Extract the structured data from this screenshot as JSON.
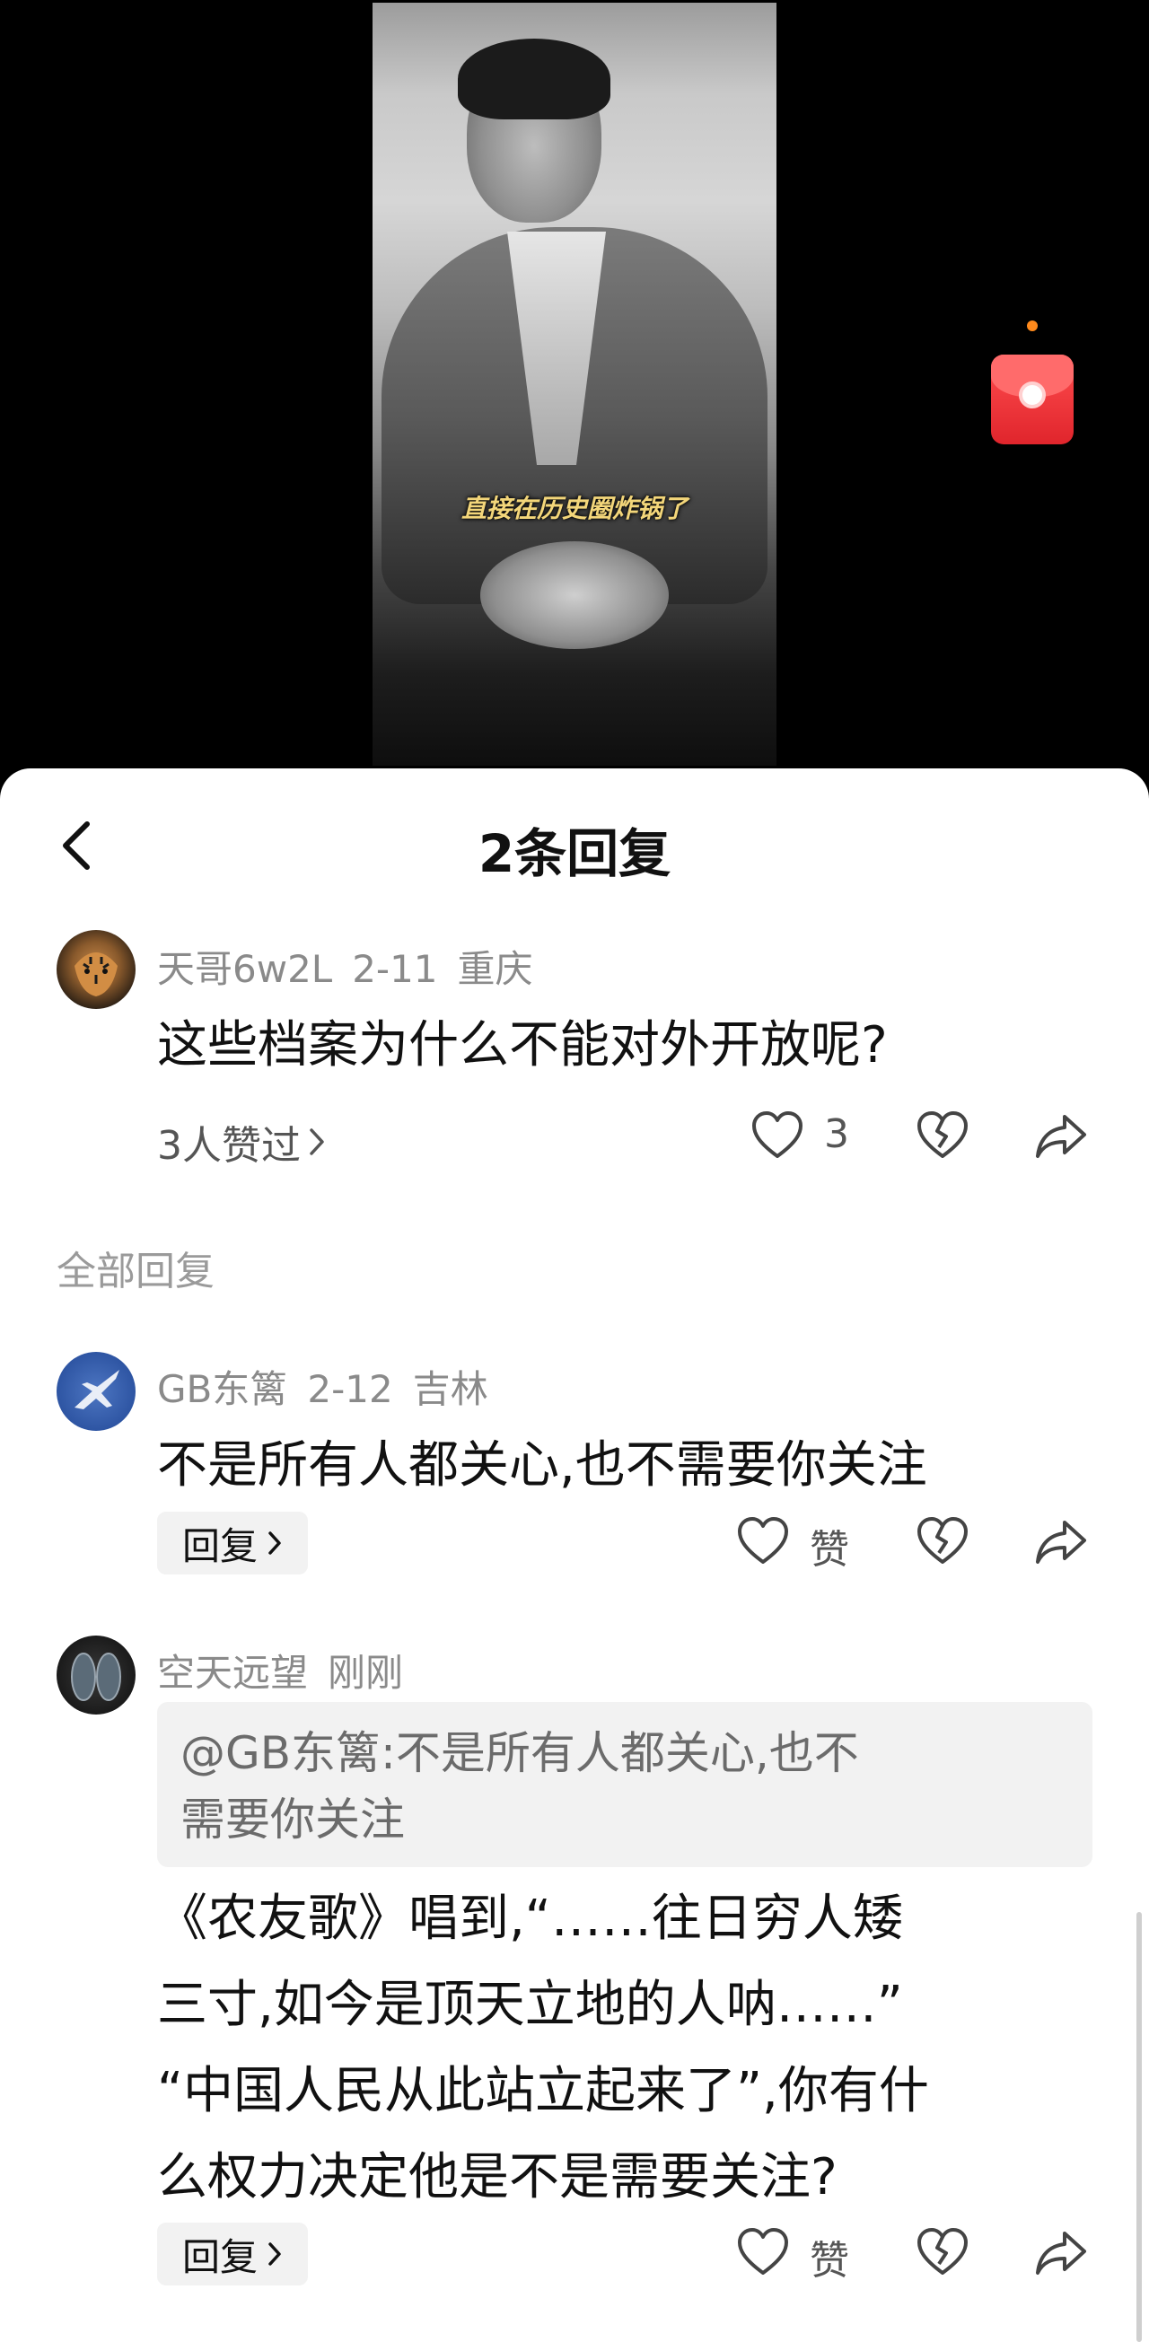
{
  "video": {
    "caption": "直接在历史圈炸锅了"
  },
  "sheet": {
    "title": "2条回复"
  },
  "main_comment": {
    "username": "天哥6w2L",
    "date": "2-11",
    "location": "重庆",
    "text": "这些档案为什么不能对外开放呢?",
    "likes_summary": "3人赞过",
    "like_count": "3",
    "avatar_icon": "tiger-avatar"
  },
  "section": {
    "label": "全部回复"
  },
  "replies": [
    {
      "username": "GB东篱",
      "date": "2-12",
      "location": "吉林",
      "text": "不是所有人都关心,也不需要你关注",
      "reply_label": "回复",
      "like_label": "赞",
      "avatar_icon": "fighter-jet-avatar"
    },
    {
      "username": "空天远望",
      "date": "刚刚",
      "quote_line1": "@GB东篱:不是所有人都关心,也不",
      "quote_line2": "需要你关注",
      "text_line1": "《农友歌》唱到,“……往日穷人矮",
      "text_line2": "三寸,如今是顶天立地的人呐……”",
      "text_line3": "“中国人民从此站立起来了”,你有什",
      "text_line4": "么权力决定他是不是需要关注?",
      "reply_label": "回复",
      "like_label": "赞",
      "avatar_icon": "masks-avatar"
    }
  ],
  "colors": {
    "accent_red": "#e0252c",
    "meta_gray": "#8a8a8a",
    "caption_gold": "#f3d67a"
  }
}
